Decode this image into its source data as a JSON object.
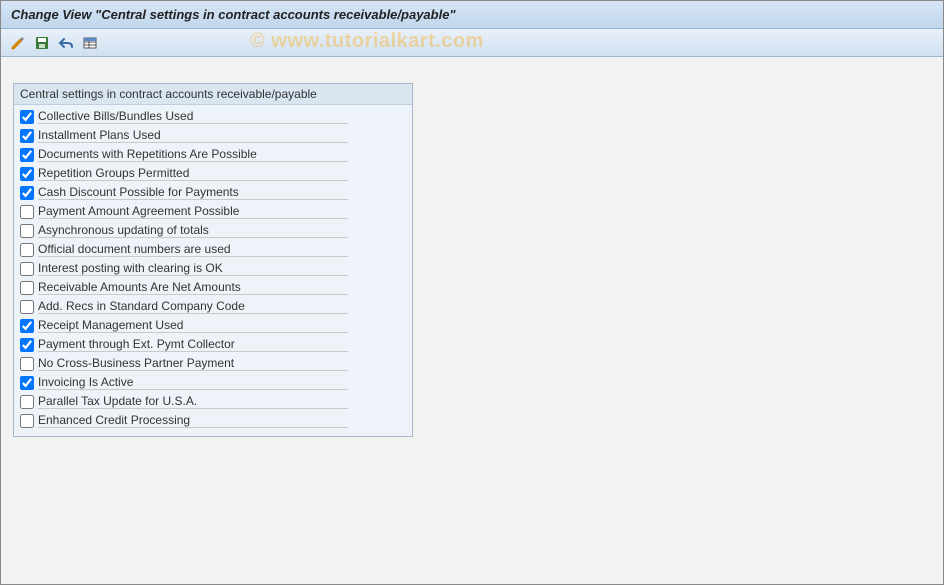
{
  "title": "Change View \"Central settings in contract accounts receivable/payable\"",
  "watermark": "© www.tutorialkart.com",
  "toolbar": {
    "btn1": "change-display-icon",
    "btn2": "save-icon",
    "btn3": "back-icon",
    "btn4": "table-settings-icon"
  },
  "groupbox": {
    "title": "Central settings in contract accounts receivable/payable",
    "items": [
      {
        "label": "Collective Bills/Bundles Used",
        "checked": true
      },
      {
        "label": "Installment Plans Used",
        "checked": true
      },
      {
        "label": "Documents with Repetitions Are Possible",
        "checked": true
      },
      {
        "label": "Repetition Groups Permitted",
        "checked": true
      },
      {
        "label": "Cash Discount Possible for Payments",
        "checked": true
      },
      {
        "label": "Payment Amount Agreement Possible",
        "checked": false
      },
      {
        "label": "Asynchronous updating of totals",
        "checked": false
      },
      {
        "label": "Official document numbers are used",
        "checked": false
      },
      {
        "label": "Interest posting with clearing is OK",
        "checked": false
      },
      {
        "label": "Receivable Amounts Are Net Amounts",
        "checked": false
      },
      {
        "label": "Add. Recs in Standard Company Code",
        "checked": false
      },
      {
        "label": "Receipt Management Used",
        "checked": true
      },
      {
        "label": "Payment through Ext. Pymt Collector",
        "checked": true
      },
      {
        "label": "No Cross-Business Partner Payment",
        "checked": false
      },
      {
        "label": "Invoicing Is Active",
        "checked": true
      },
      {
        "label": "Parallel Tax Update for U.S.A.",
        "checked": false
      },
      {
        "label": "Enhanced Credit Processing",
        "checked": false
      }
    ]
  }
}
